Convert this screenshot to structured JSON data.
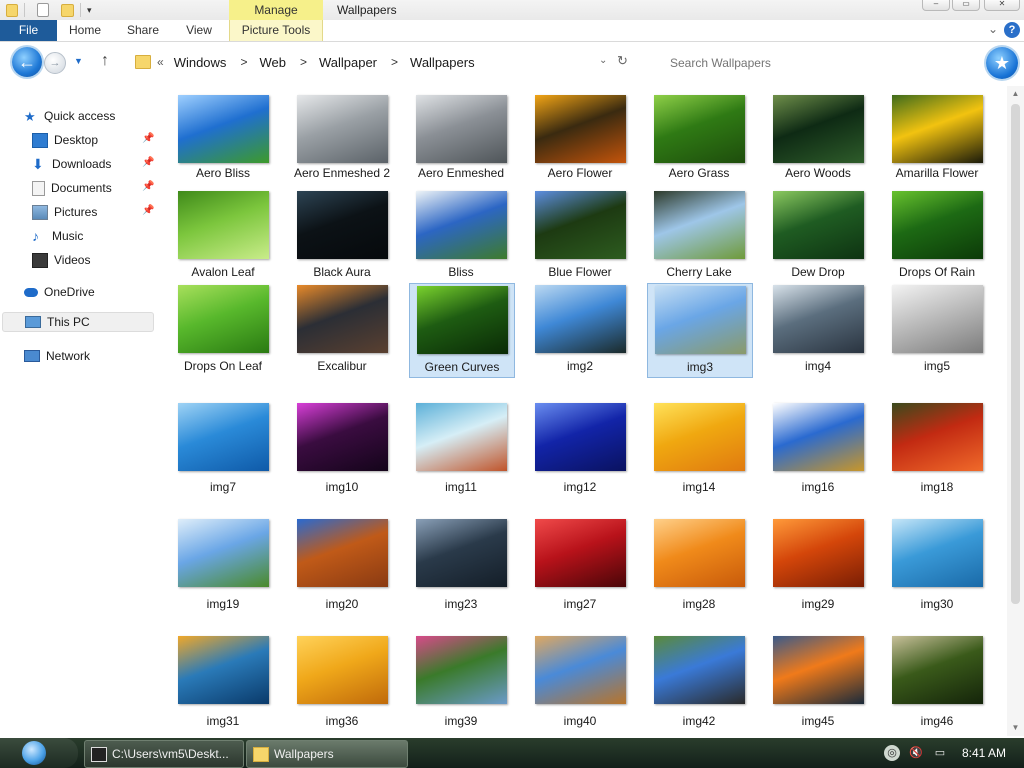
{
  "window": {
    "title": "Wallpapers",
    "context_tab_header": "Manage",
    "controls": [
      "minimize",
      "maximize",
      "close"
    ]
  },
  "ribbon": {
    "tabs": [
      "File",
      "Home",
      "Share",
      "View",
      "Picture Tools"
    ]
  },
  "address_bar": {
    "overflow": "«",
    "breadcrumbs": [
      "Windows",
      "Web",
      "Wallpaper",
      "Wallpapers"
    ],
    "search_placeholder": "Search Wallpapers"
  },
  "nav_pane": {
    "quick_access": "Quick access",
    "items": [
      {
        "label": "Desktop",
        "pinned": true
      },
      {
        "label": "Downloads",
        "pinned": true
      },
      {
        "label": "Documents",
        "pinned": true
      },
      {
        "label": "Pictures",
        "pinned": true
      },
      {
        "label": "Music",
        "pinned": false
      },
      {
        "label": "Videos",
        "pinned": false
      }
    ],
    "onedrive": "OneDrive",
    "this_pc": "This PC",
    "network": "Network"
  },
  "files": [
    {
      "name": "Aero Bliss",
      "colors": [
        "#1f6fd0",
        "#9fd0ff",
        "#3d9a2a"
      ]
    },
    {
      "name": "Aero Enmeshed 2",
      "colors": [
        "#9aa0a5",
        "#e6e8ea",
        "#5b6268"
      ]
    },
    {
      "name": "Aero Enmeshed",
      "colors": [
        "#8b9096",
        "#dfe2e5",
        "#4f5559"
      ]
    },
    {
      "name": "Aero Flower",
      "colors": [
        "#3a2a10",
        "#f2a516",
        "#c4540b"
      ]
    },
    {
      "name": "Aero Grass",
      "colors": [
        "#2f7a14",
        "#8fd048",
        "#1e4d0c"
      ]
    },
    {
      "name": "Aero Woods",
      "colors": [
        "#0e2a14",
        "#6f8f4a",
        "#2e5c2a"
      ]
    },
    {
      "name": "Amarilla Flower",
      "colors": [
        "#f2c310",
        "#3e6b1c",
        "#1a1a0a"
      ]
    },
    {
      "name": "Avalon Leaf",
      "colors": [
        "#7cc63d",
        "#3f8a1a",
        "#c9ec8a"
      ]
    },
    {
      "name": "Black Aura",
      "colors": [
        "#0c1216",
        "#2d4454",
        "#06090c"
      ]
    },
    {
      "name": "Bliss",
      "colors": [
        "#2c66c4",
        "#eef4f7",
        "#3e7b2c"
      ]
    },
    {
      "name": "Blue Flower",
      "colors": [
        "#1d3a12",
        "#5d8ee0",
        "#2d5c1f"
      ]
    },
    {
      "name": "Cherry Lake",
      "colors": [
        "#9ec6e8",
        "#2d3a2a",
        "#6f9a3a"
      ]
    },
    {
      "name": "Dew Drop",
      "colors": [
        "#1f5c22",
        "#8bc960",
        "#0e3312"
      ]
    },
    {
      "name": "Drops Of Rain",
      "colors": [
        "#1d6a14",
        "#68c22e",
        "#0c3a08"
      ]
    },
    {
      "name": "Drops On Leaf",
      "colors": [
        "#58b82c",
        "#a8e05c",
        "#2a7a12"
      ]
    },
    {
      "name": "Excalibur",
      "colors": [
        "#2b2e35",
        "#e88a2a",
        "#5a4030"
      ]
    },
    {
      "name": "Green Curves",
      "colors": [
        "#1e5c12",
        "#7ad22e",
        "#0a2a06"
      ]
    },
    {
      "name": "img2",
      "colors": [
        "#3f88d6",
        "#bcd9f2",
        "#1b2a2a"
      ]
    },
    {
      "name": "img3",
      "colors": [
        "#6aa6e6",
        "#c6dff4",
        "#8a9a6a"
      ]
    },
    {
      "name": "img4",
      "colors": [
        "#5b6e7e",
        "#d8e2ea",
        "#2a3440"
      ]
    },
    {
      "name": "img5",
      "colors": [
        "#bdbdbd",
        "#f3f3f3",
        "#7c7c7c"
      ]
    },
    {
      "name": "img7",
      "colors": [
        "#2a8ad8",
        "#9fd3f5",
        "#0f5aa8"
      ]
    },
    {
      "name": "img10",
      "colors": [
        "#3a0c40",
        "#d83fd8",
        "#14041a"
      ]
    },
    {
      "name": "img11",
      "colors": [
        "#d6eef6",
        "#5cb0d8",
        "#c0542a"
      ]
    },
    {
      "name": "img12",
      "colors": [
        "#1224a8",
        "#6a8ef0",
        "#0a1260"
      ]
    },
    {
      "name": "img14",
      "colors": [
        "#f0a810",
        "#ffe25a",
        "#e07a10"
      ]
    },
    {
      "name": "img16",
      "colors": [
        "#2a6ad0",
        "#ffffff",
        "#c8962a"
      ]
    },
    {
      "name": "img18",
      "colors": [
        "#c22a12",
        "#3a4a1c",
        "#f06a2a"
      ]
    },
    {
      "name": "img19",
      "colors": [
        "#6aa6e6",
        "#dfeefa",
        "#4a8a2a"
      ]
    },
    {
      "name": "img20",
      "colors": [
        "#c05a18",
        "#2a6ad0",
        "#8a3a12"
      ]
    },
    {
      "name": "img23",
      "colors": [
        "#2a3a4a",
        "#8aa0b8",
        "#141e28"
      ]
    },
    {
      "name": "img27",
      "colors": [
        "#b8121a",
        "#f04a4a",
        "#4a0608"
      ]
    },
    {
      "name": "img28",
      "colors": [
        "#f08a1a",
        "#ffd08a",
        "#c85a0a"
      ]
    },
    {
      "name": "img29",
      "colors": [
        "#d4460a",
        "#ff9a3a",
        "#7a1e04"
      ]
    },
    {
      "name": "img30",
      "colors": [
        "#3a9ad8",
        "#c6e6f8",
        "#1a6aa8"
      ]
    },
    {
      "name": "img31",
      "colors": [
        "#2a7ab8",
        "#f0a82a",
        "#0a3a6a"
      ]
    },
    {
      "name": "img36",
      "colors": [
        "#f0a81a",
        "#ffd25a",
        "#c06a0a"
      ]
    },
    {
      "name": "img39",
      "colors": [
        "#3a7a2a",
        "#d84a8a",
        "#6a9ac8"
      ]
    },
    {
      "name": "img40",
      "colors": [
        "#4a8ad8",
        "#e0a860",
        "#b8742a"
      ]
    },
    {
      "name": "img42",
      "colors": [
        "#3a7ad8",
        "#5a8a3a",
        "#2a2a2a"
      ]
    },
    {
      "name": "img45",
      "colors": [
        "#f07a1a",
        "#3a5a8a",
        "#1a2a3a"
      ]
    },
    {
      "name": "img46",
      "colors": [
        "#3a5a1a",
        "#c8c09a",
        "#14240a"
      ]
    }
  ],
  "selected_files": [
    "Green Curves",
    "img3"
  ],
  "taskbar": {
    "buttons": [
      "C:\\Users\\vm5\\Deskt...",
      "Wallpapers"
    ],
    "clock": "8:41 AM"
  },
  "colors": {
    "accent": "#1e5b9a",
    "selection": "#cfe4f7",
    "context_tab": "#f6f08a"
  }
}
